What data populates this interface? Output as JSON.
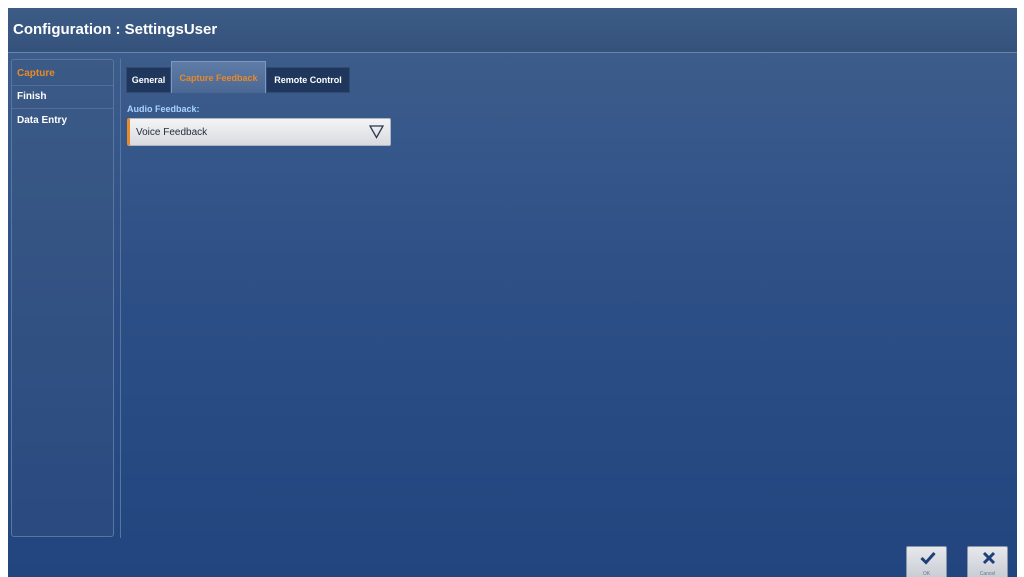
{
  "window": {
    "title": "Configuration : SettingsUser"
  },
  "sidebar": {
    "items": [
      {
        "label": "Capture",
        "active": true
      },
      {
        "label": "Finish",
        "active": false
      },
      {
        "label": "Data Entry",
        "active": false
      }
    ]
  },
  "tabs": [
    {
      "label": "General",
      "active": false
    },
    {
      "label": "Capture Feedback",
      "active": true
    },
    {
      "label": "Remote Control",
      "active": false
    }
  ],
  "form": {
    "audio_feedback_label": "Audio Feedback:",
    "audio_feedback_value": "Voice Feedback"
  },
  "footer": {
    "ok_label": "OK",
    "cancel_label": "Cancel"
  },
  "colors": {
    "accent": "#e8892a",
    "label_blue": "#a9d4ff",
    "background": "#2e5087"
  },
  "icons": {
    "dropdown": "triangle-down-icon",
    "ok": "checkmark-icon",
    "cancel": "close-icon"
  }
}
